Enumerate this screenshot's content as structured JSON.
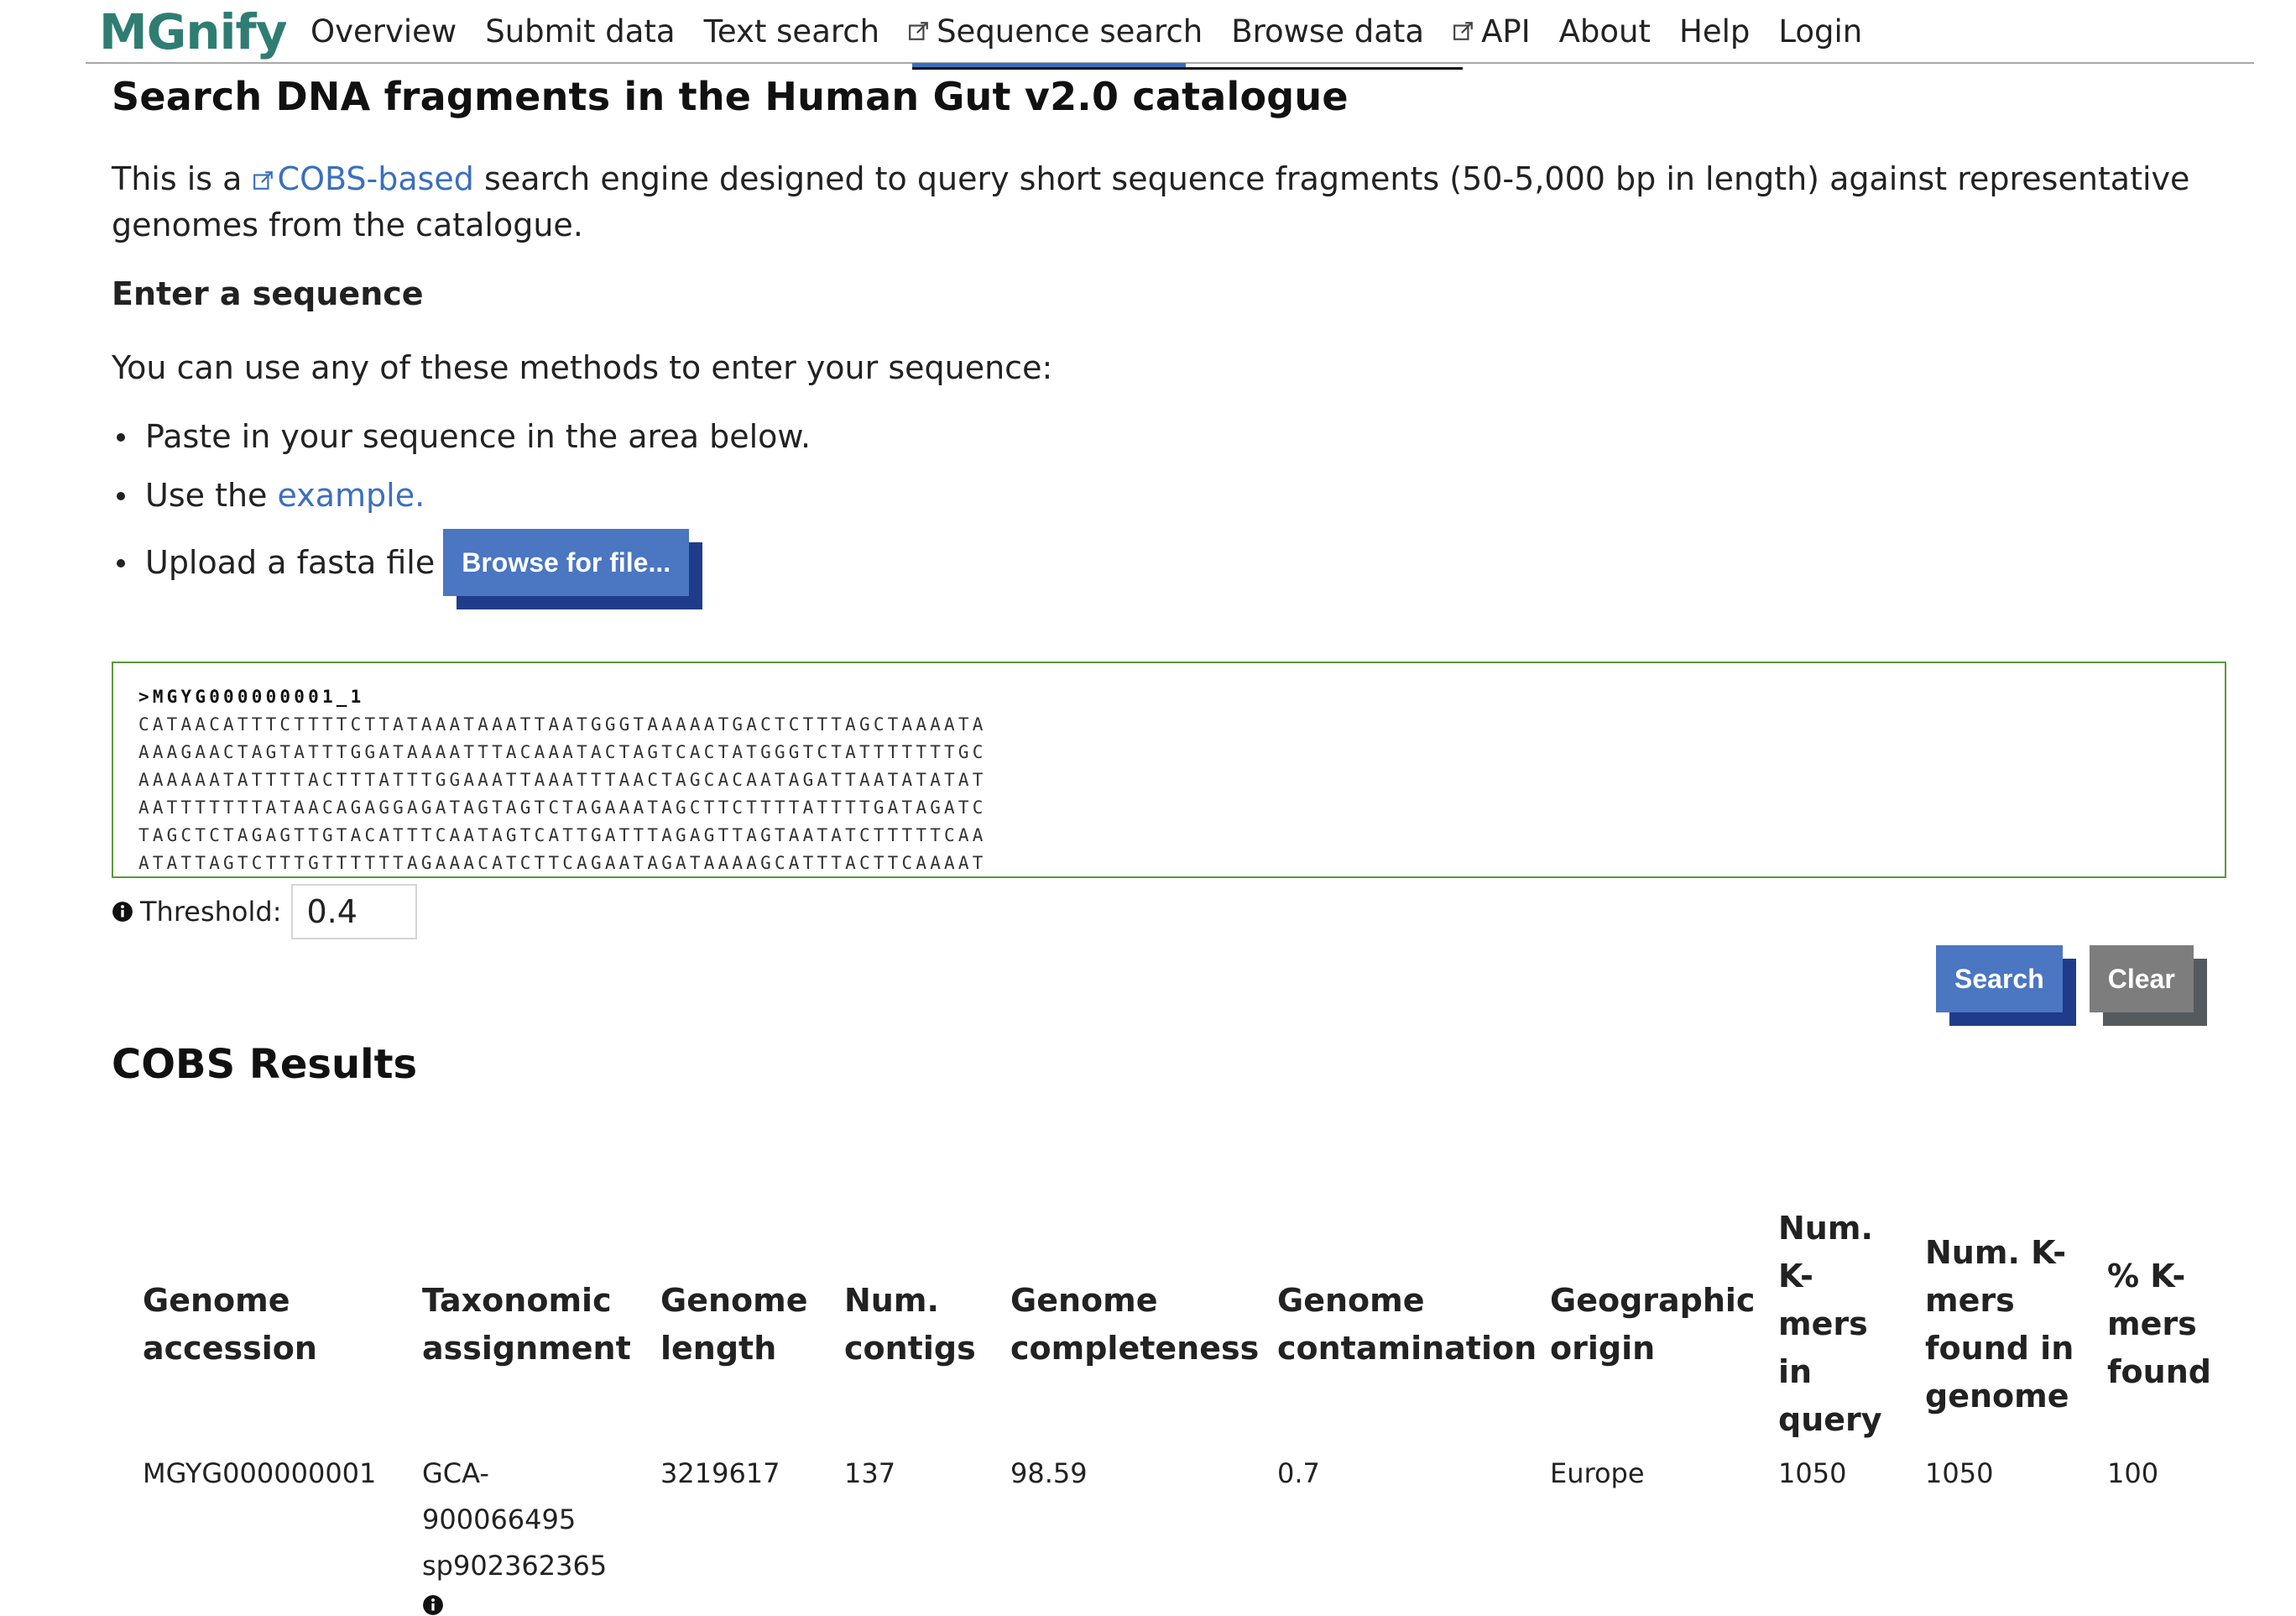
{
  "header": {
    "logo": "MGnify",
    "nav": [
      {
        "label": "Overview",
        "external": false
      },
      {
        "label": "Submit data",
        "external": false
      },
      {
        "label": "Text search",
        "external": false
      },
      {
        "label": "Sequence search",
        "external": true,
        "active": true
      },
      {
        "label": "Browse data",
        "external": false
      },
      {
        "label": "API",
        "external": true
      },
      {
        "label": "About",
        "external": false
      },
      {
        "label": "Help",
        "external": false
      },
      {
        "label": "Login",
        "external": false
      }
    ]
  },
  "page": {
    "title": "Search DNA fragments in the Human Gut v2.0 catalogue",
    "intro_prefix": "This is a",
    "intro_link": "COBS-based",
    "intro_suffix": "search engine designed to query short sequence fragments (50-5,000 bp in length) against representative genomes from the catalogue.",
    "enter_heading": "Enter a sequence",
    "methods_intro": "You can use any of these methods to enter your sequence:",
    "method_paste": "Paste in your sequence in the area below.",
    "method_example_prefix": "Use the",
    "method_example_link": "example.",
    "method_upload": "Upload a fasta file",
    "browse_button": "Browse for file...",
    "sequence": {
      "header": ">MGYG000000001_1",
      "lines": [
        "CATAACATTTCTTTTCTTATAAATAAATTAATGGGTAAAAATGACTCTTTAGCTAAAATA",
        "AAAGAACTAGTATTTGGATAAAATTTACAAATACTAGTCACTATGGGTCTATTTTTTTGC",
        "AAAAAATATTTTACTTTATTTGGAAATTAAATTTAACTAGCACAATAGATTAATATATAT",
        "AATTTTTTTATAACAGAGGAGATAGTAGTCTAGAAATAGCTTCTTTTATTTTGATAGATC",
        "TAGCTCTAGAGTTGTACATTTCAATAGTCATTGATTTAGAGTTAGTAATATCTTTTTCAA",
        "ATATTAGTCTTTGTTTTTTAGAAACATCTTCAGAATAGATAAAAGCATTTACTTCAAAAT"
      ]
    },
    "threshold_label": "Threshold:",
    "threshold_value": "0.4",
    "search_button": "Search",
    "clear_button": "Clear",
    "results_title": "COBS Results"
  },
  "results": {
    "columns": [
      "Genome accession",
      "Taxonomic assignment",
      "Genome length",
      "Num. contigs",
      "Genome completeness",
      "Genome contamination",
      "Geographic origin",
      "Num. K-mers in query",
      "Num. K-mers found in genome",
      "% K-mers found"
    ],
    "rows": [
      {
        "accession": "MGYG000000001",
        "taxonomy_1": "GCA-",
        "taxonomy_2": "900066495",
        "taxonomy_3": "sp902362365",
        "length": "3219617",
        "contigs": "137",
        "completeness": "98.59",
        "contamination": "0.7",
        "origin": "Europe",
        "kmers_query": "1050",
        "kmers_found": "1050",
        "pct_found": "100"
      }
    ]
  }
}
